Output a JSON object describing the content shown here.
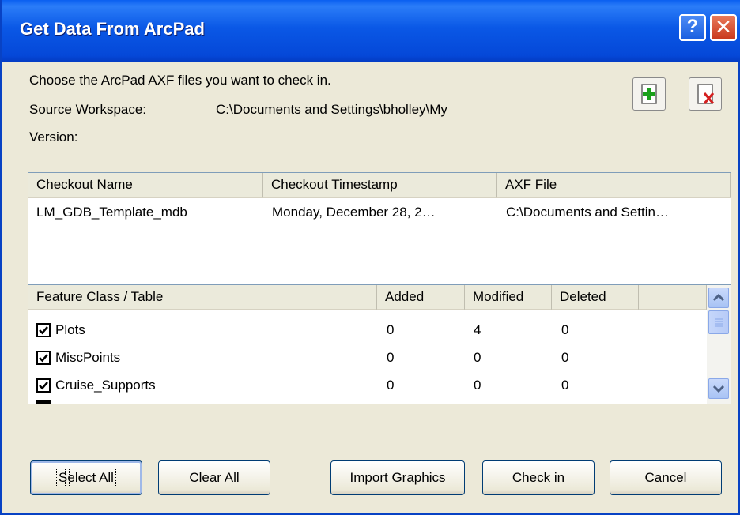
{
  "window": {
    "title": "Get Data From ArcPad",
    "help_glyph": "?",
    "close_glyph": "✕"
  },
  "info": {
    "instruction": "Choose the ArcPad AXF files you want to check in.",
    "source_label": "Source Workspace:",
    "source_value": "C:\\Documents and Settings\\bholley\\My",
    "version_label": "Version:"
  },
  "icons": {
    "add": "add-file-icon",
    "remove": "remove-file-icon"
  },
  "checkout_list": {
    "headers": [
      "Checkout Name",
      "Checkout Timestamp",
      "AXF File"
    ],
    "rows": [
      [
        "LM_GDB_Template_mdb",
        "Monday, December 28, 2…",
        "C:\\Documents and Settin…"
      ]
    ]
  },
  "feature_list": {
    "headers": [
      "Feature Class / Table",
      "Added",
      "Modified",
      "Deleted"
    ],
    "rows": [
      {
        "name": "Plots",
        "added": "0",
        "modified": "4",
        "deleted": "0",
        "checked": true
      },
      {
        "name": "MiscPoints",
        "added": "0",
        "modified": "0",
        "deleted": "0",
        "checked": true
      },
      {
        "name": "Cruise_Supports",
        "added": "0",
        "modified": "0",
        "deleted": "0",
        "checked": true
      }
    ]
  },
  "buttons": {
    "select_all": {
      "mnemonic": "S",
      "rest": "elect All"
    },
    "clear_all": {
      "mnemonic": "C",
      "rest": "lear All"
    },
    "import_graphics": {
      "mnemonic": "I",
      "rest": "mport Graphics"
    },
    "check_in": {
      "pre": "Ch",
      "mnemonic": "e",
      "rest": "ck in"
    },
    "cancel": "Cancel"
  },
  "colors": {
    "titlebar": "#0a58e6",
    "dialog_bg": "#ece9d8",
    "border": "#0842c4"
  }
}
